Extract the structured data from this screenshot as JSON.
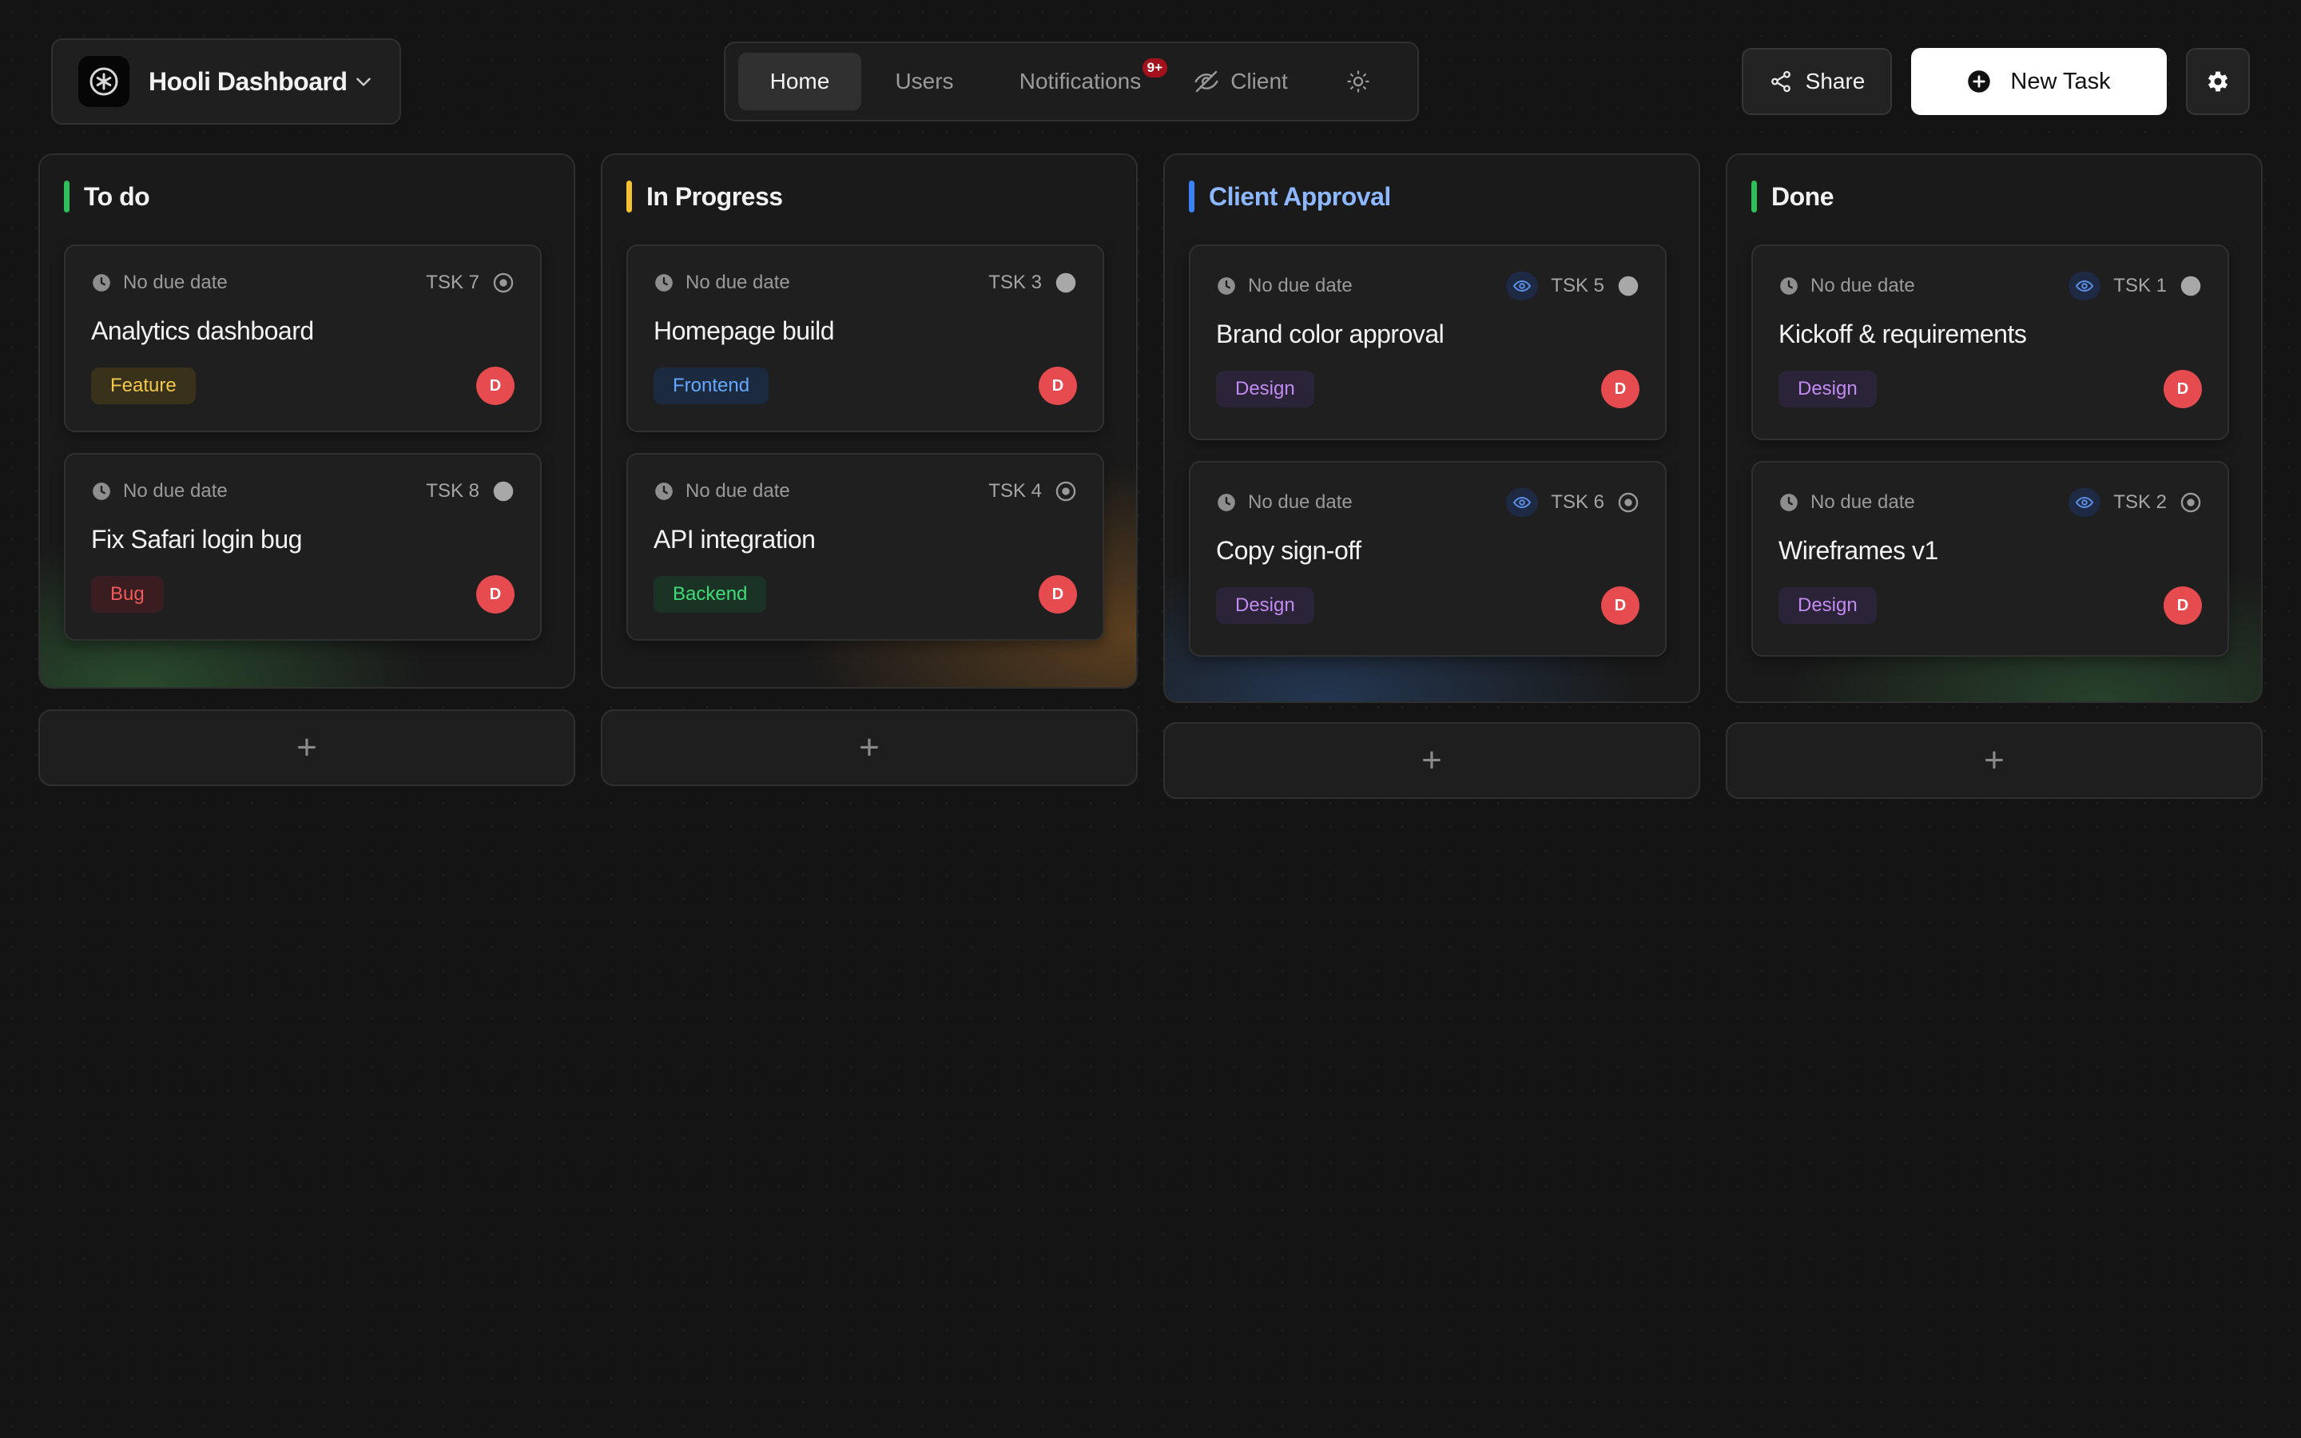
{
  "header": {
    "workspace_title": "Hooli Dashboard",
    "nav": {
      "home": "Home",
      "users": "Users",
      "notifications": "Notifications",
      "notifications_badge": "9+",
      "client": "Client"
    },
    "share_label": "Share",
    "new_task_label": "New Task"
  },
  "columns": [
    {
      "title": "To do",
      "accent": "#2fbf5b",
      "title_color": "#f2f2f2",
      "add_label": "+",
      "cards": [
        {
          "due": "No due date",
          "id": "TSK 7",
          "title": "Analytics dashboard",
          "tag": "Feature",
          "avatar": "D",
          "status": "target",
          "client_visible": false
        },
        {
          "due": "No due date",
          "id": "TSK 8",
          "title": "Fix Safari login bug",
          "tag": "Bug",
          "avatar": "D",
          "status": "filled",
          "client_visible": false
        }
      ]
    },
    {
      "title": "In Progress",
      "accent": "#f2c233",
      "title_color": "#f2f2f2",
      "add_label": "+",
      "cards": [
        {
          "due": "No due date",
          "id": "TSK 3",
          "title": "Homepage build",
          "tag": "Frontend",
          "avatar": "D",
          "status": "filled",
          "client_visible": false
        },
        {
          "due": "No due date",
          "id": "TSK 4",
          "title": "API integration",
          "tag": "Backend",
          "avatar": "D",
          "status": "target",
          "client_visible": false
        }
      ]
    },
    {
      "title": "Client Approval",
      "accent": "#3b82f6",
      "title_color": "#8db8ff",
      "add_label": "+",
      "cards": [
        {
          "due": "No due date",
          "id": "TSK 5",
          "title": "Brand color approval",
          "tag": "Design",
          "avatar": "D",
          "status": "filled",
          "client_visible": true
        },
        {
          "due": "No due date",
          "id": "TSK 6",
          "title": "Copy sign-off",
          "tag": "Design",
          "avatar": "D",
          "status": "target",
          "client_visible": true
        }
      ]
    },
    {
      "title": "Done",
      "accent": "#2fbf5b",
      "title_color": "#f2f2f2",
      "add_label": "+",
      "cards": [
        {
          "due": "No due date",
          "id": "TSK 1",
          "title": "Kickoff & requirements",
          "tag": "Design",
          "avatar": "D",
          "status": "filled",
          "client_visible": true
        },
        {
          "due": "No due date",
          "id": "TSK 2",
          "title": "Wireframes v1",
          "tag": "Design",
          "avatar": "D",
          "status": "target",
          "client_visible": true
        }
      ]
    }
  ],
  "icons": {
    "workspace_logo": "asterisk-logo-icon",
    "workspace_menu": "chevron-down-icon",
    "client_toggle": "eye-off-icon",
    "theme_toggle": "sun-icon",
    "share": "share-icon",
    "new_task": "plus-circle-icon",
    "settings": "gear-icon",
    "due": "clock-icon",
    "client_visible": "eye-icon",
    "status_target": "target-circle-icon",
    "status_filled": "filled-circle-icon"
  },
  "colors": {
    "avatar": "#e54b4f",
    "notification_badge": "#a3121c",
    "primary_button": "#ffffff"
  }
}
